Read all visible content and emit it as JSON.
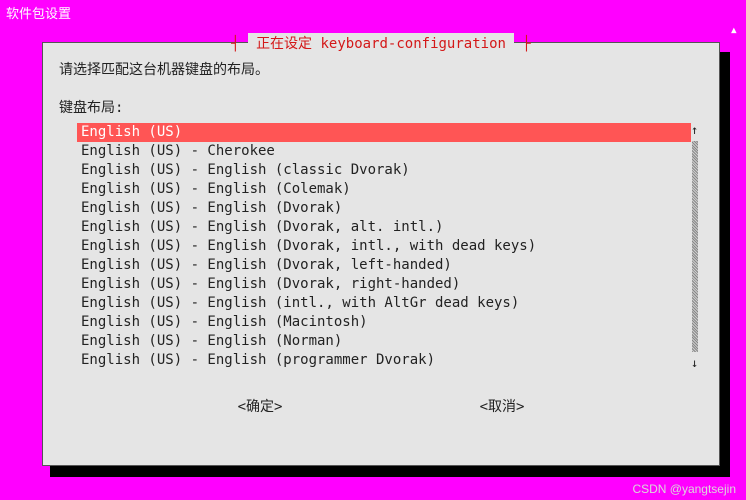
{
  "window": {
    "title": "软件包设置"
  },
  "dialog": {
    "title": "正在设定 keyboard-configuration",
    "instruction": "请选择匹配这台机器键盘的布局。",
    "list_label": "键盘布局:",
    "selected_index": 0,
    "items": [
      "English (US)",
      "English (US) - Cherokee",
      "English (US) - English (classic Dvorak)",
      "English (US) - English (Colemak)",
      "English (US) - English (Dvorak)",
      "English (US) - English (Dvorak, alt. intl.)",
      "English (US) - English (Dvorak, intl., with dead keys)",
      "English (US) - English (Dvorak, left-handed)",
      "English (US) - English (Dvorak, right-handed)",
      "English (US) - English (intl., with AltGr dead keys)",
      "English (US) - English (Macintosh)",
      "English (US) - English (Norman)",
      "English (US) - English (programmer Dvorak)"
    ],
    "buttons": {
      "ok": "<确定>",
      "cancel": "<取消>"
    }
  },
  "scroll": {
    "up_arrow": "↑",
    "down_arrow": "↓",
    "outer_up": "▴"
  },
  "watermark": "CSDN @yangtsejin"
}
